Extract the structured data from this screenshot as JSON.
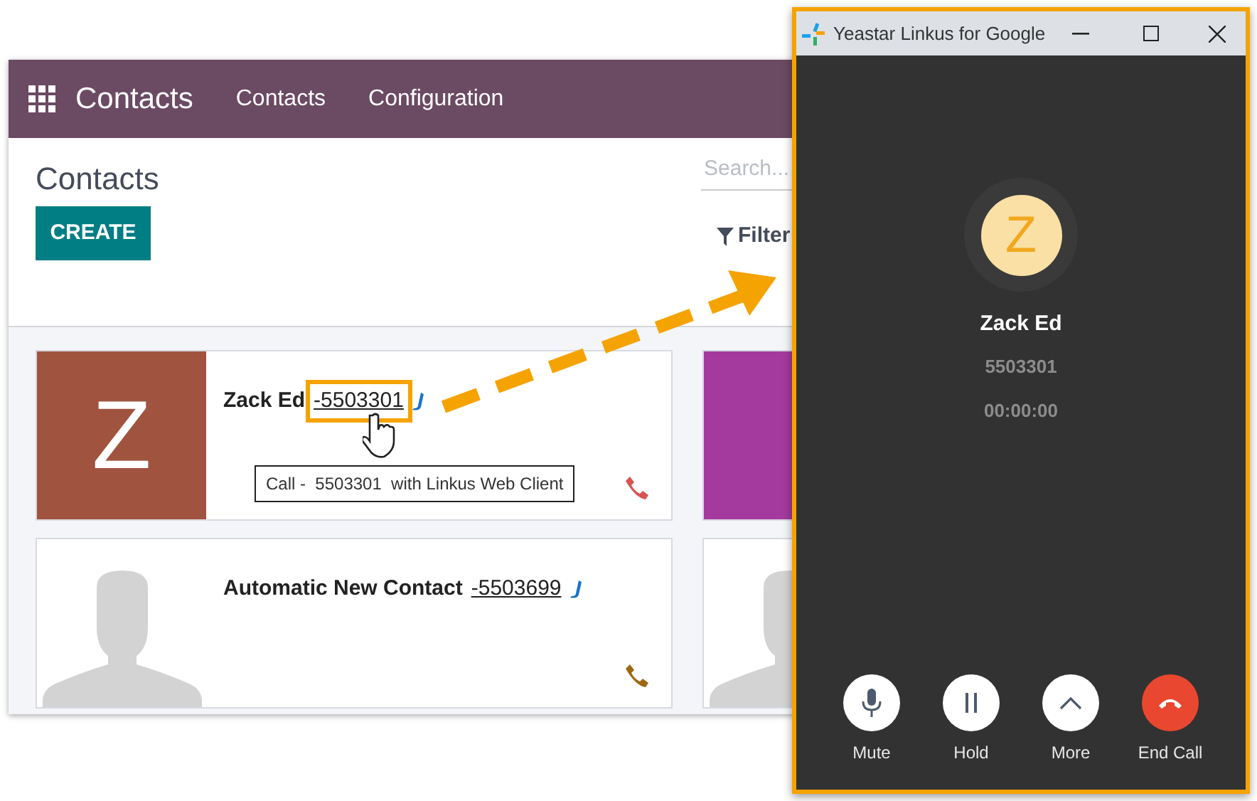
{
  "contacts_app": {
    "app_title": "Contacts",
    "menu": [
      {
        "label": "Contacts"
      },
      {
        "label": "Configuration"
      }
    ],
    "page_title": "Contacts",
    "create_button": "CREATE",
    "search": {
      "placeholder": "Search..."
    },
    "filters_button": "Filter",
    "cards": [
      {
        "name": "Zack Ed",
        "phone": "-5503301",
        "highlighted": true,
        "avatar": {
          "kind": "letter",
          "letter": "Z",
          "color": "#a0533e"
        },
        "call_icon": {
          "color": "#d9534f"
        }
      },
      {
        "avatar": {
          "kind": "plain",
          "color": "#a43a9e"
        }
      },
      {
        "name": "Automatic New Contact",
        "phone": "-5503699",
        "highlighted": false,
        "avatar": {
          "kind": "silhouette"
        },
        "call_icon": {
          "color": "#9c6a12"
        }
      },
      {
        "avatar": {
          "kind": "silhouette"
        }
      }
    ],
    "tooltip": "Call -  5503301  with Linkus Web Client"
  },
  "call_window": {
    "title": "Yeastar Linkus for Google",
    "caller": {
      "letter": "Z",
      "name": "Zack Ed",
      "number": "5503301"
    },
    "timer": "00:00:00",
    "actions": [
      {
        "kind": "mute",
        "label": "Mute"
      },
      {
        "kind": "hold",
        "label": "Hold"
      },
      {
        "kind": "more",
        "label": "More"
      },
      {
        "kind": "end",
        "label": "End Call"
      }
    ]
  }
}
